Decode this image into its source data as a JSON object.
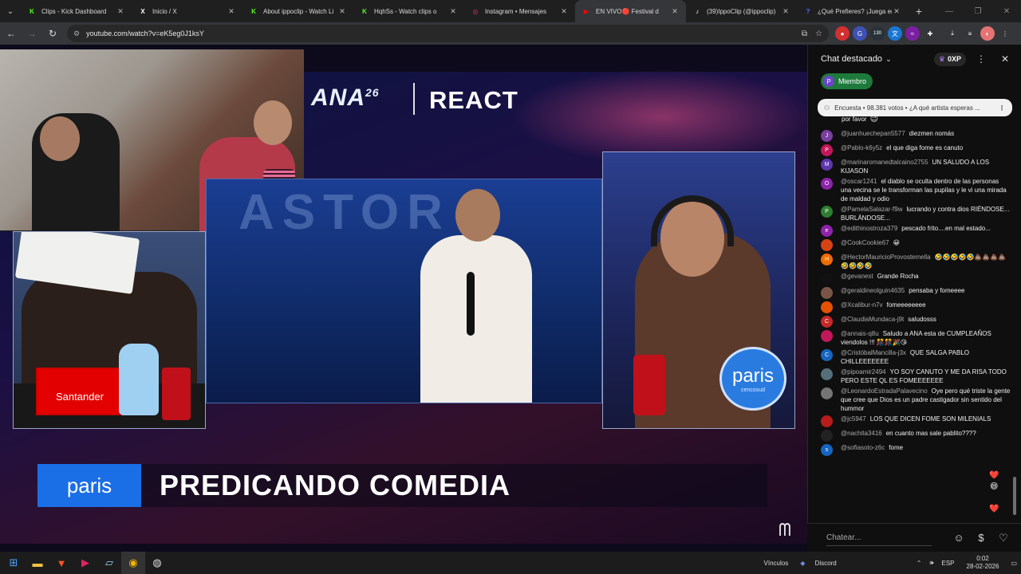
{
  "browser": {
    "tabs": [
      {
        "title": "Clips - Kick Dashboard",
        "favicon": "K",
        "favicon_color": "#53fc18",
        "active": false
      },
      {
        "title": "Inicio / X",
        "favicon": "X",
        "favicon_color": "#ffffff",
        "active": false
      },
      {
        "title": "About ippoclip - Watch Li",
        "favicon": "K",
        "favicon_color": "#53fc18",
        "active": false
      },
      {
        "title": "HqhSs - Watch clips o",
        "favicon": "K",
        "favicon_color": "#53fc18",
        "active": false
      },
      {
        "title": "Instagram • Mensajes",
        "favicon": "◎",
        "favicon_color": "#e1306c",
        "active": false
      },
      {
        "title": "EN VIVO🔴 Festival d",
        "favicon": "▶",
        "favicon_color": "#ff0000",
        "active": true
      },
      {
        "title": "(39)IppoClip (@ippoclip)",
        "favicon": "♪",
        "favicon_color": "#ffffff",
        "active": false
      },
      {
        "title": "¿Qué Prefieres? ¡Juega en",
        "favicon": "?",
        "favicon_color": "#4a6cf7",
        "active": false
      }
    ],
    "url": "youtube.com/watch?v=eK5eg0J1ksY",
    "ext_badge": "130"
  },
  "video": {
    "logo_text": "ANA",
    "logo_sup": "26",
    "react_label": "REACT",
    "center_bg_word": "ASTOR",
    "sponsor_left": "Santander",
    "sponsor_box": "paris",
    "sponsor_round": "paris",
    "sponsor_round_sub": "cencosud",
    "headline": "PREDICANDO COMEDIA"
  },
  "chat": {
    "title": "Chat destacado",
    "xp": "0XP",
    "member_chip": "Miembro",
    "member_initial": "P",
    "poll_text": "Encuesta • 98.381 votos • ¿A qué artista esperas ...",
    "partial_message": "por favor",
    "messages": [
      {
        "user": "@juanhuechepan5577",
        "text": "diezmen nomás",
        "initial": "J",
        "color": "#7b3fa0"
      },
      {
        "user": "@Pablo-k6y5z",
        "text": "el que diga fome es canuto",
        "initial": "P",
        "color": "#c2185b"
      },
      {
        "user": "@marinaromanedtalcaino2755",
        "text": "UN SALUDO A LOS KIJASON",
        "initial": "M",
        "color": "#5e35b1"
      },
      {
        "user": "@oscar1241",
        "text": "el diablo se oculta dentro de las personas una vecina se le transforman las pupilas y le vi una mirada de maldad y odio",
        "initial": "O",
        "color": "#8e24aa"
      },
      {
        "user": "@PamelaSalazar-f9w",
        "text": "lucrando y contra dios RIÉNDOSE... BURLÁNDOSE...",
        "initial": "P",
        "color": "#2e7d32"
      },
      {
        "user": "@edithinostroza379",
        "text": "pescado frito....en mal estado...",
        "initial": "e",
        "color": "#8e24aa"
      },
      {
        "user": "@CookCookie67",
        "text": "😀",
        "initial": "",
        "color": "#d84315"
      },
      {
        "user": "@HectorMauricioProvostemella",
        "text": "🤣🤣🤣🤣🤣💩💩💩💩🤣🤣🤣🤣",
        "initial": "H",
        "color": "#ef6c00"
      },
      {
        "user": "@gevanest",
        "text": "Grande Rocha",
        "initial": "",
        "color": "#111111"
      },
      {
        "user": "@geraldineolguin4635",
        "text": "pensaba y fomeeee",
        "initial": "",
        "color": "#795548"
      },
      {
        "user": "@Xcalibur-n7v",
        "text": "fomeeeeeeee",
        "initial": "",
        "color": "#e65100"
      },
      {
        "user": "@ClaudiaMundaca-j9t",
        "text": "saludosss",
        "initial": "C",
        "color": "#c62828"
      },
      {
        "user": "@annais-q8u",
        "text": "Saludo a ANA esta de CUMPLEAÑOS viendolos !!! 🎊🎊🎉😘",
        "initial": "",
        "color": "#c2185b"
      },
      {
        "user": "@CristóbalMancilla-j3x",
        "text": "QUE SALGA PABLO CHILLEEEEEEE",
        "initial": "C",
        "color": "#1565c0"
      },
      {
        "user": "@pipoamir2494",
        "text": "YO SOY CANUTO Y ME DA RISA TODO PERO ESTE QL ES FOMEEEEEEE",
        "initial": "",
        "color": "#546e7a"
      },
      {
        "user": "@LeonardoEstradaPalavecino",
        "text": "Oye pero qué triste la gente que cree que Dios es un padre castigador sin sentido del hummor",
        "initial": "",
        "color": "#757575"
      },
      {
        "user": "@jc5947",
        "text": "LOS QUE DICEN FOME SON MILENIALS",
        "initial": "",
        "color": "#b71c1c"
      },
      {
        "user": "@nachita3416",
        "text": "en cuanto mas sale pablito????",
        "initial": "",
        "color": "#222222"
      },
      {
        "user": "@sofiasoto-z6c",
        "text": "fome",
        "initial": "s",
        "color": "#1565c0"
      }
    ],
    "input_placeholder": "Chatear..."
  },
  "taskbar": {
    "links_label": "Vínculos",
    "discord_label": "Discord",
    "lang": "ESP",
    "time": "0:02",
    "date": "28-02-2026"
  }
}
